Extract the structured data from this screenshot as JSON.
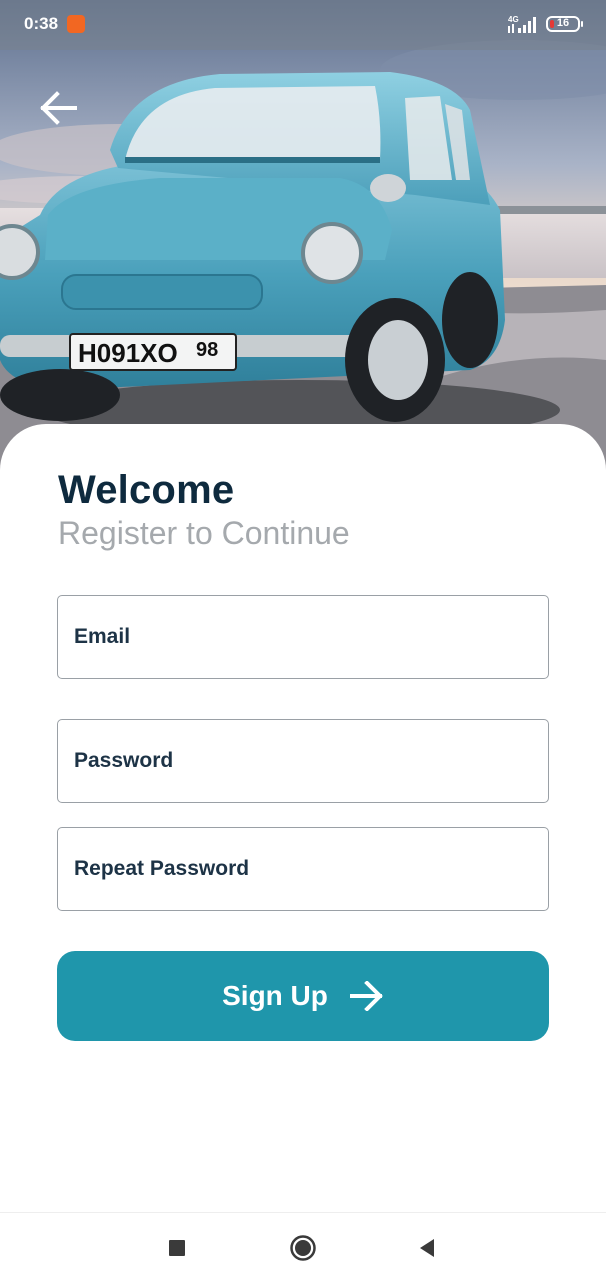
{
  "status_bar": {
    "time": "0:38",
    "network": "4G",
    "battery_level": "16",
    "battery_fraction": 0.16,
    "notification_color": "#f26722"
  },
  "header": {
    "back_icon": "arrow-left-icon"
  },
  "card": {
    "title": "Welcome",
    "subtitle": "Register to Continue"
  },
  "form": {
    "email": {
      "placeholder": "Email",
      "value": ""
    },
    "password": {
      "placeholder": "Password",
      "value": ""
    },
    "repeat_password": {
      "placeholder": "Repeat Password",
      "value": ""
    },
    "signup_label": "Sign Up",
    "signup_icon": "arrow-right-icon"
  },
  "nav_bar": {
    "recents_icon": "square-icon",
    "home_icon": "circle-icon",
    "back_icon": "triangle-back-icon"
  },
  "colors": {
    "accent": "#1f96ab",
    "title": "#0e2a3e",
    "subtitle": "#a5a9ad",
    "field_text": "#1d3346",
    "field_border": "#9aa0a6"
  }
}
